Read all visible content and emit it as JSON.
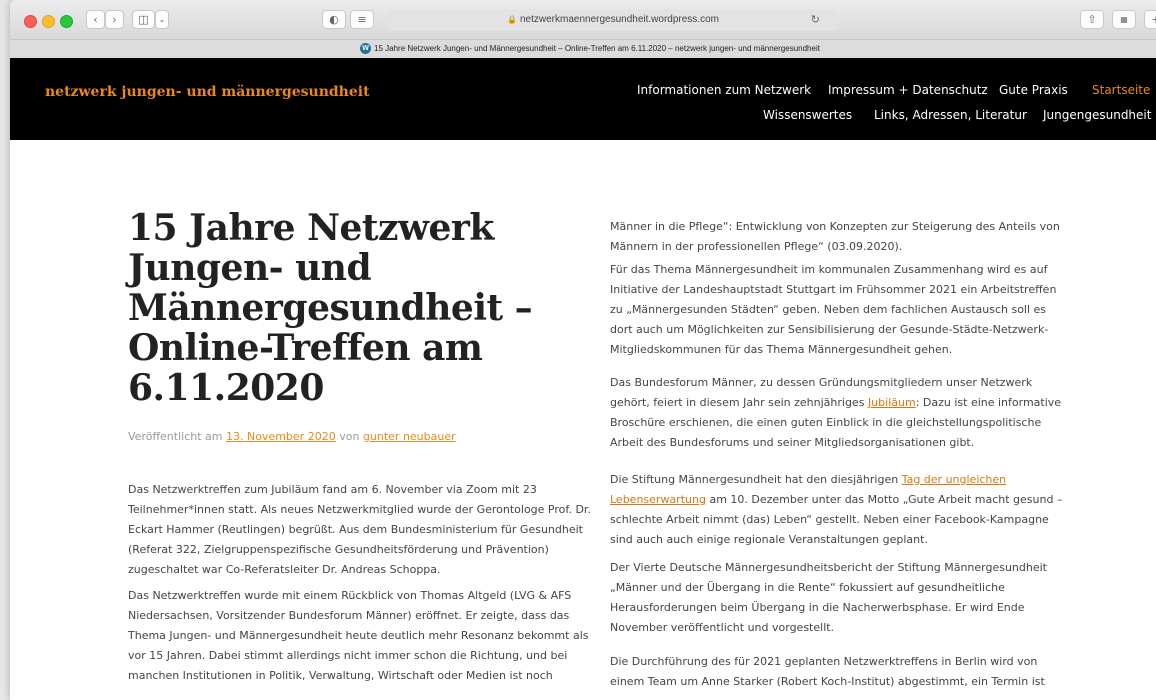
{
  "browser": {
    "address": "netzwerkmaennergesundheit.wordpress.com",
    "tab_title": "15 Jahre Netzwerk Jungen- und Männergesundheit – Online-Treffen am 6.11.2020 – netzwerk jungen- und männergesundheit"
  },
  "site": {
    "title": "netzwerk jungen- und männergesundheit",
    "nav": [
      {
        "label": "Informationen zum Netzwerk"
      },
      {
        "label": "Impressum + Datenschutz"
      },
      {
        "label": "Gute Praxis"
      },
      {
        "label": "Startseite"
      },
      {
        "label": "Wissenswertes"
      },
      {
        "label": "Links, Adressen, Literatur"
      },
      {
        "label": "Jungengesundheit"
      }
    ],
    "accent_color": "#e8891d"
  },
  "post": {
    "title": "15 Jahre Netzwerk Jungen- und Männergesundheit – Online-Treffen am 6.11.2020",
    "meta_prefix": "Veröffentlicht am",
    "date": "13. November 2020",
    "meta_by": "von",
    "author": "gunter neubauer",
    "left_paragraphs": [
      "Das Netzwerktreffen zum Jubiläum fand am 6. November via Zoom mit 23 Teilnehmer*innen statt. Als neues Netzwerkmitglied wurde der Gerontologe Prof. Dr. Eckart Hammer (Reutlingen) begrüßt. Aus dem Bundesministerium für Gesundheit (Referat 322, Zielgruppenspezifische Gesundheitsförderung und Prävention) zugeschaltet war Co-Referatsleiter Dr. Andreas Schoppa.",
      "Das Netzwerktreffen wurde mit einem Rückblick von Thomas Altgeld (LVG & AFS Niedersachsen, Vorsitzender Bundesforum Männer) eröffnet. Er zeigte, dass das Thema Jungen- und Männergesundheit heute deutlich mehr Resonanz bekommt als vor 15 Jahren. Dabei stimmt allerdings nicht immer schon die Richtung, und bei manchen Institutionen in Politik, Verwaltung, Wirtschaft oder Medien ist noch"
    ],
    "right_p1": "Männer in die Pflege“: Entwicklung von Konzepten zur Steigerung des Anteils von Männern in der professionellen Pflege“ (03.09.2020).",
    "right_p2": "Für das Thema Männergesundheit im kommunalen Zusammenhang wird es auf Initiative der Landeshauptstadt Stuttgart im Frühsommer 2021 ein Arbeitstreffen zu „Männergesunden Städten“ geben. Neben dem fachlichen Austausch soll es dort auch um Möglichkeiten zur Sensibilisierung der Gesunde-Städte-Netzwerk-Mitgliedskommunen für das Thema Männergesundheit gehen.",
    "right_p3_a": "Das Bundesforum Männer, zu dessen Gründungsmitgliedern unser Netzwerk gehört, feiert in diesem Jahr sein zehnjähriges ",
    "right_p3_link": "Jubiläum",
    "right_p3_b": ": Dazu ist eine informative Broschüre erschienen, die einen guten Einblick in die gleichstellungspolitische Arbeit des Bundesforums und seiner Mitgliedsorganisationen gibt.",
    "right_p4_a": "Die Stiftung Männergesundheit hat den diesjährigen ",
    "right_p4_link": "Tag der ungleichen Lebenserwartung",
    "right_p4_b": " am 10. Dezember unter das Motto „Gute Arbeit macht gesund – schlechte Arbeit nimmt (das) Leben“ gestellt. Neben einer Facebook-Kampagne sind auch auch einige regionale Veranstaltungen geplant.",
    "right_p5": "Der Vierte Deutsche Männergesundheitsbericht der Stiftung Männergesundheit „Männer und der Übergang in die Rente“ fokussiert auf gesundheitliche Herausforderungen beim Übergang in die Nacherwerbsphase. Er wird Ende November veröffentlicht und vorgestellt.",
    "right_p6": "Die Durchführung des für 2021 geplanten Netzwerktreffens in Berlin wird von einem Team um Anne Starker (Robert Koch-Institut) abgestimmt, ein Termin ist"
  }
}
